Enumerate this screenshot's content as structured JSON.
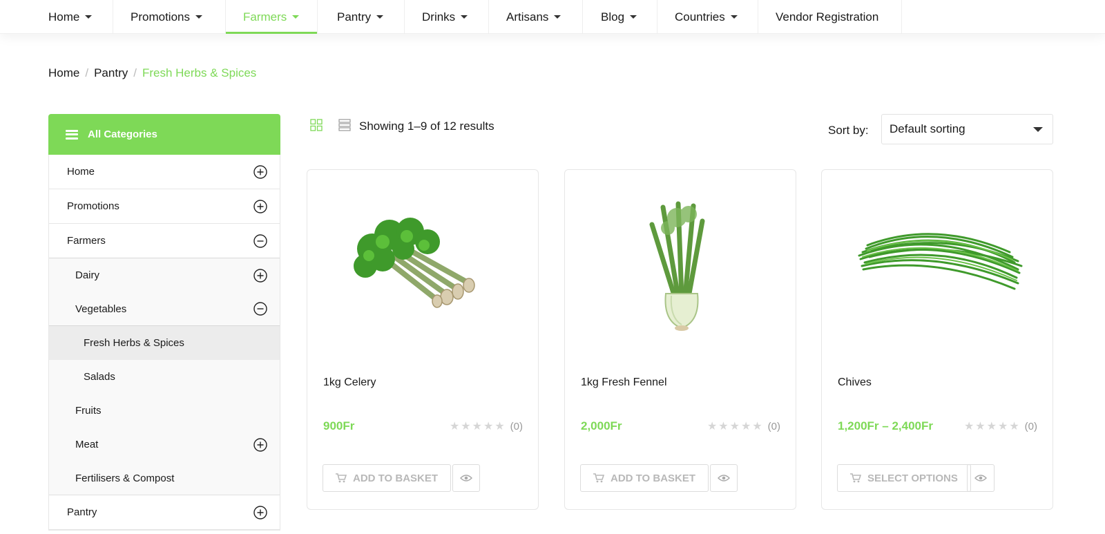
{
  "nav": {
    "items": [
      {
        "label": "Home",
        "dropdown": true,
        "active": false
      },
      {
        "label": "Promotions",
        "dropdown": true,
        "active": false
      },
      {
        "label": "Farmers",
        "dropdown": true,
        "active": true
      },
      {
        "label": "Pantry",
        "dropdown": true,
        "active": false
      },
      {
        "label": "Drinks",
        "dropdown": true,
        "active": false
      },
      {
        "label": "Artisans",
        "dropdown": true,
        "active": false
      },
      {
        "label": "Blog",
        "dropdown": true,
        "active": false
      },
      {
        "label": "Countries",
        "dropdown": true,
        "active": false
      },
      {
        "label": "Vendor Registration",
        "dropdown": false,
        "active": false
      }
    ]
  },
  "breadcrumb": {
    "items": [
      "Home",
      "Pantry"
    ],
    "current": "Fresh Herbs & Spices"
  },
  "sidebar": {
    "title": "All Categories",
    "categories": [
      {
        "label": "Home",
        "toggle": "plus"
      },
      {
        "label": "Promotions",
        "toggle": "plus"
      },
      {
        "label": "Farmers",
        "toggle": "minus"
      },
      {
        "label": "Dairy",
        "toggle": "plus"
      },
      {
        "label": "Vegetables",
        "toggle": "minus"
      },
      {
        "label": "Fresh Herbs & Spices",
        "selected": true
      },
      {
        "label": "Salads"
      },
      {
        "label": "Fruits"
      },
      {
        "label": "Meat",
        "toggle": "plus"
      },
      {
        "label": "Fertilisers & Compost"
      },
      {
        "label": "Pantry",
        "toggle": "plus"
      }
    ]
  },
  "toolbar": {
    "results_text": "Showing 1–9 of 12 results",
    "sort_label": "Sort by:",
    "sort_value": "Default sorting"
  },
  "products": [
    {
      "name": "1kg Celery",
      "price": "900Fr",
      "rating": 0,
      "reviews": "(0)",
      "button": "ADD TO BASKET",
      "image": "celery"
    },
    {
      "name": "1kg Fresh Fennel",
      "price": "2,000Fr",
      "rating": 0,
      "reviews": "(0)",
      "button": "ADD TO BASKET",
      "image": "fennel"
    },
    {
      "name": "Chives",
      "price": "1,200Fr – 2,400Fr",
      "rating": 0,
      "reviews": "(0)",
      "button": "SELECT OPTIONS",
      "image": "chives"
    }
  ],
  "colors": {
    "accent": "#7ed957",
    "text": "#1a1a1a",
    "muted": "#b8b8b8",
    "border": "#e6e6e6"
  },
  "icons": {
    "menu": "hamburger-icon",
    "grid_view": "grid-view-icon",
    "list_view": "list-view-icon",
    "cart": "cart-icon",
    "quick_view": "eye-icon",
    "expand": "plus-circle-icon",
    "collapse": "minus-circle-icon",
    "star": "star-icon"
  }
}
